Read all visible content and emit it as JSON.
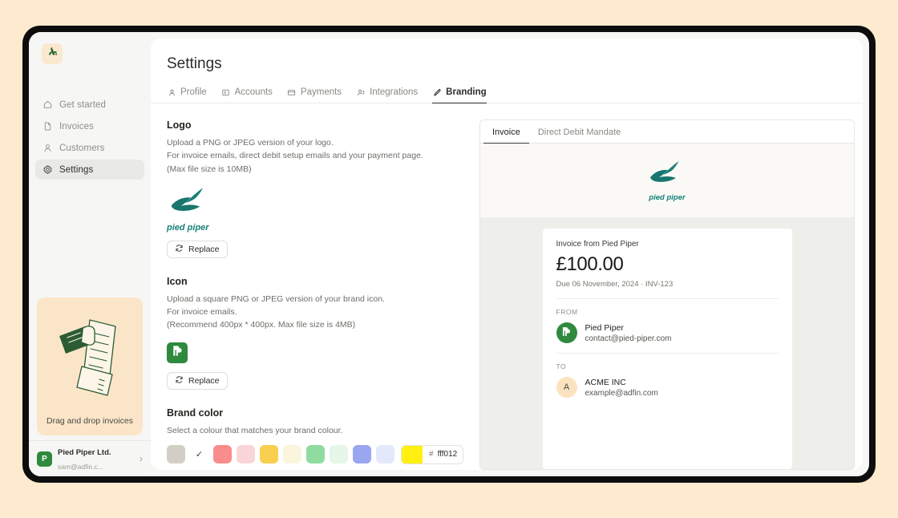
{
  "app": {
    "logo_icon": "adfin-logo-icon"
  },
  "sidebar": {
    "items": [
      {
        "label": "Get started",
        "icon": "home-icon",
        "active": false
      },
      {
        "label": "Invoices",
        "icon": "document-icon",
        "active": false
      },
      {
        "label": "Customers",
        "icon": "person-icon",
        "active": false
      },
      {
        "label": "Settings",
        "icon": "gear-icon",
        "active": true
      }
    ],
    "dropzone": {
      "label": "Drag and drop invoices",
      "art": "hand-holding-invoices-illustration"
    },
    "user": {
      "avatar_letter": "P",
      "name": "Pied Piper Ltd.",
      "email": "sam@adfin.c..."
    }
  },
  "header": {
    "title": "Settings"
  },
  "tabs": [
    {
      "label": "Profile",
      "icon": "person-icon",
      "active": false
    },
    {
      "label": "Accounts",
      "icon": "card-icon",
      "active": false
    },
    {
      "label": "Payments",
      "icon": "credit-card-icon",
      "active": false
    },
    {
      "label": "Integrations",
      "icon": "plug-icon",
      "active": false
    },
    {
      "label": "Branding",
      "icon": "pencil-icon",
      "active": true
    }
  ],
  "logo_section": {
    "title": "Logo",
    "description": "Upload a PNG or JPEG version of your logo.\nFor invoice emails, direct debit setup emails and your payment page.\n(Max file size is 10MB)",
    "wordmark": "pied piper",
    "wordmark_color": "#16807a",
    "replace_label": "Replace",
    "replace_icon": "refresh-icon"
  },
  "icon_section": {
    "title": "Icon",
    "description": "Upload a square PNG or JPEG version of your brand icon.\nFor invoice emails.\n(Recommend 400px * 400px. Max file size is 4MB)",
    "icon_monogram": "PP",
    "icon_bg": "#2f8a3d",
    "replace_label": "Replace",
    "replace_icon": "refresh-icon"
  },
  "brand_color_section": {
    "title": "Brand color",
    "description": "Select a colour that matches your brand colour.",
    "swatches": [
      {
        "color": "#d4cfc6",
        "selected": true
      },
      {
        "color": "#f98c8c",
        "selected": false
      },
      {
        "color": "#fad5d8",
        "selected": false
      },
      {
        "color": "#f8cf4e",
        "selected": false
      },
      {
        "color": "#faf5dc",
        "selected": false
      },
      {
        "color": "#8fdba0",
        "selected": false
      },
      {
        "color": "#e6f6e9",
        "selected": false
      },
      {
        "color": "#9aa6f0",
        "selected": false
      },
      {
        "color": "#e4e8fb",
        "selected": false
      }
    ],
    "check_glyph": "✓",
    "hex_prefix": "#",
    "hex_value": "fff012",
    "hex_chip_color": "#fff012"
  },
  "preview": {
    "tabs": [
      {
        "label": "Invoice",
        "active": true
      },
      {
        "label": "Direct Debit Mandate",
        "active": false
      }
    ],
    "hero_wordmark": "pied piper",
    "invoice": {
      "from_line": "Invoice from Pied Piper",
      "amount": "£100.00",
      "due_line": "Due 06 November, 2024 · INV-123",
      "from_label": "FROM",
      "from_party": {
        "avatar_monogram": "PP",
        "avatar_bg": "#2f8a3d",
        "name": "Pied Piper",
        "email": "contact@pied-piper.com"
      },
      "to_label": "TO",
      "to_party": {
        "avatar_monogram": "A",
        "avatar_bg": "#fbe3c0",
        "name": "ACME INC",
        "email": "example@adfin.com"
      }
    }
  }
}
